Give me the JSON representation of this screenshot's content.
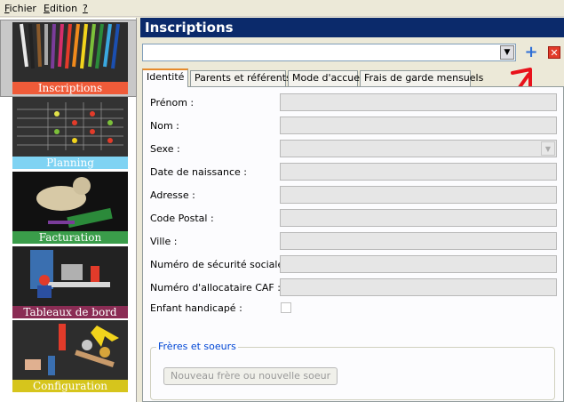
{
  "menu": {
    "items": [
      "Fichier",
      "Edition",
      "?"
    ]
  },
  "sidebar": {
    "modules": [
      {
        "label": "Inscriptions",
        "selected": true,
        "color": "#ef5b39"
      },
      {
        "label": "Planning",
        "selected": false,
        "color": "#7fd3f3"
      },
      {
        "label": "Facturation",
        "selected": false,
        "color": "#3a9d4a"
      },
      {
        "label": "Tableaux de bord",
        "selected": false,
        "color": "#8a2c54"
      },
      {
        "label": "Configuration",
        "selected": false,
        "color": "#d6c51c"
      }
    ]
  },
  "header": {
    "title": "Inscriptions",
    "color": "#0b2a6b"
  },
  "toolbar": {
    "combo_value": "",
    "combo_arrow": "▼",
    "add_icon": "+",
    "delete_icon": "✕"
  },
  "tabs": [
    {
      "label": "Identité",
      "active": true
    },
    {
      "label": "Parents et référents",
      "active": false
    },
    {
      "label": "Mode d'accueil",
      "active": false
    },
    {
      "label": "Frais de garde mensuels",
      "active": false
    }
  ],
  "form": {
    "fields": [
      {
        "label": "Prénom :",
        "value": ""
      },
      {
        "label": "Nom :",
        "value": ""
      },
      {
        "label": "Sexe :",
        "value": ""
      },
      {
        "label": "Date de naissance :",
        "value": ""
      },
      {
        "label": "Adresse :",
        "value": ""
      },
      {
        "label": "Code Postal :",
        "value": ""
      },
      {
        "label": "Ville :",
        "value": ""
      },
      {
        "label": "Numéro de sécurité sociale :",
        "value": ""
      },
      {
        "label": "Numéro d'allocataire CAF :",
        "value": ""
      }
    ],
    "handicap_label": "Enfant handicapé :",
    "handicap_checked": false,
    "siblings": {
      "title": "Frères et soeurs",
      "add_button": "Nouveau frère ou nouvelle soeur"
    }
  },
  "accent": {
    "active_tab": "#e68b2c",
    "arrow": "#e8121b"
  }
}
